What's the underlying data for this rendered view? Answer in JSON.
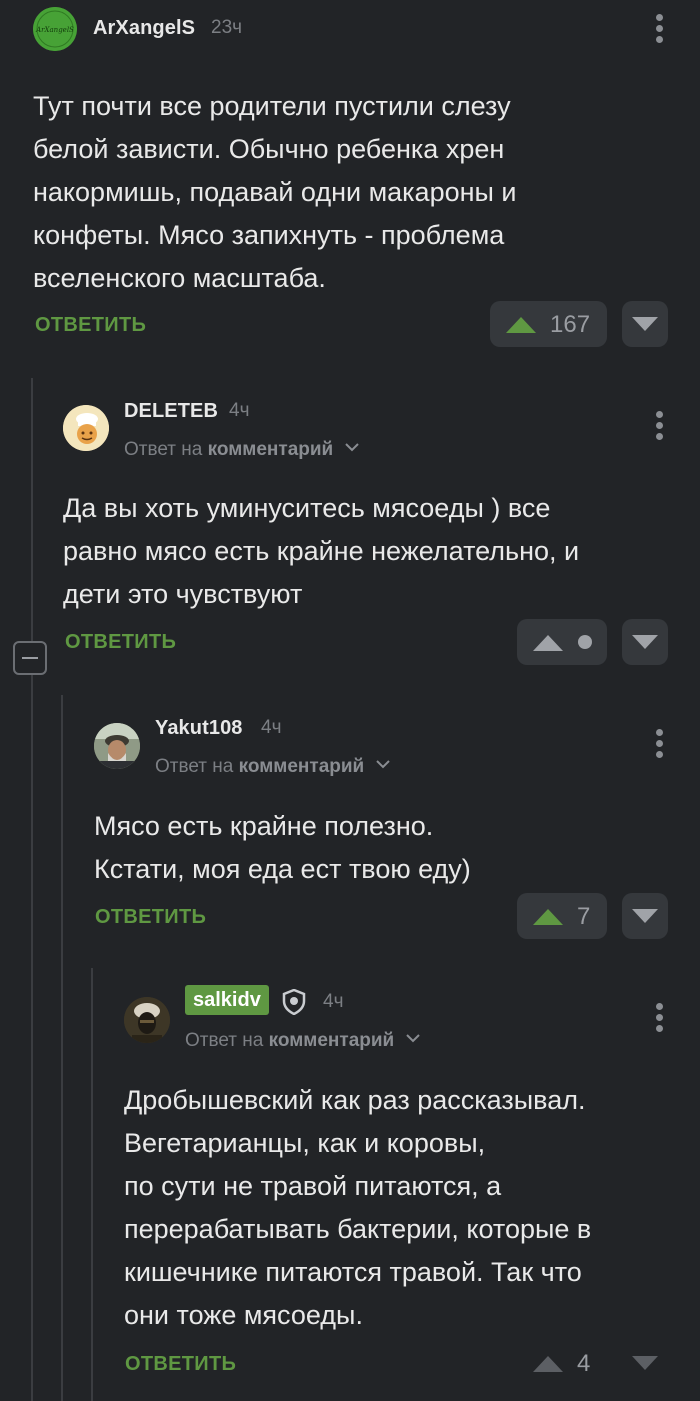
{
  "colors": {
    "background": "#222427",
    "accent_green": "#5f9842",
    "muted": "#7c7f84",
    "vote_box": "#35383c"
  },
  "comments": [
    {
      "author": "ArXangelS",
      "avatar_text": "ArXangelS",
      "time": "23ч",
      "reply_prefix": "",
      "reply_link": "",
      "lines": [
        "Тут почти все родители пустили слезу",
        "белой зависти. Обычно ребенка хрен",
        "накормишь, подавай одни макароны и",
        "конфеты. Мясо запихнуть - проблема",
        "вселенского масштаба."
      ],
      "reply_label": "ОТВЕТИТЬ",
      "rating": "167",
      "upvote_icon": "upvote-arrow-icon",
      "downvote_icon": "downvote-arrow-icon"
    },
    {
      "author": "DELETEB",
      "time": "4ч",
      "reply_prefix": "Ответ на ",
      "reply_link": "комментарий",
      "lines": [
        "Да вы хоть уминуситесь мясоеды ) все",
        "равно мясо есть крайне нежелательно, и",
        "дети это чувствуют"
      ],
      "reply_label": "ОТВЕТИТЬ",
      "rating": "",
      "rating_hidden_icon": "rating-hidden-dot-icon"
    },
    {
      "author": "Yakut108",
      "time": "4ч",
      "reply_prefix": "Ответ на ",
      "reply_link": "комментарий",
      "lines": [
        "Мясо есть крайне полезно.",
        "Кстати, моя еда ест твою еду)"
      ],
      "reply_label": "ОТВЕТИТЬ",
      "rating": "7"
    },
    {
      "author": "salkidv",
      "author_badge_icon": "shield-icon",
      "time": "4ч",
      "reply_prefix": "Ответ на ",
      "reply_link": "комментарий",
      "lines": [
        "Дробышевский как раз рассказывал.",
        "Вегетарианцы, как и коровы,",
        "по сути не травой питаются, а",
        "перерабатывать бактерии, которые в",
        "кишечнике питаются травой. Так что",
        "они тоже мясоеды."
      ],
      "reply_label": "ОТВЕТИТЬ",
      "rating": "4"
    }
  ]
}
